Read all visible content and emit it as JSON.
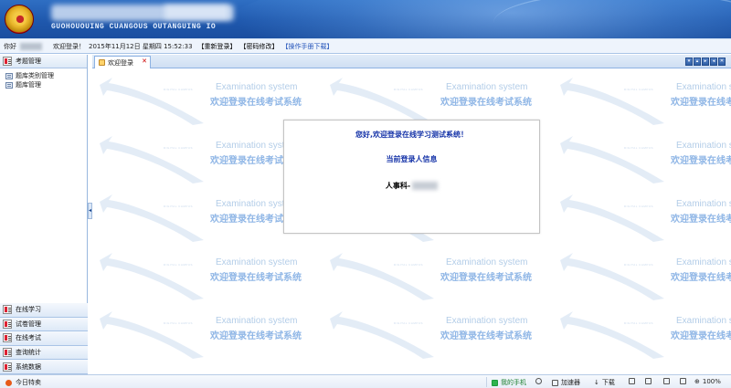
{
  "header": {
    "subtitle": "GUOHOUOUING CUANGOUS OUTANGUING IO"
  },
  "infobar": {
    "greeting": "你好",
    "welcome": "欢迎登录！",
    "datetime": "2015年11月12日 星期四 15:52:33",
    "relogin": "【重新登录】",
    "change_password": "【密码修改】",
    "manual_download": "【操作手册下载】"
  },
  "sidebar": {
    "top_section": "考题管理",
    "tree": [
      {
        "label": "题库类别管理"
      },
      {
        "label": "题库管理"
      }
    ],
    "bottom_sections": [
      {
        "label": "在线学习"
      },
      {
        "label": "试卷管理"
      },
      {
        "label": "在线考试"
      },
      {
        "label": "查询统计"
      },
      {
        "label": "系统数据"
      }
    ]
  },
  "tabs": {
    "active_label": "欢迎登录",
    "close_glyph": "✕",
    "tools": [
      "▾",
      "▴",
      "▸",
      "◂",
      "✕"
    ]
  },
  "watermark": {
    "english": "Examination system",
    "chinese": "欢迎登录在线考试系统",
    "tiny": "DIGITAL CAMPUS"
  },
  "dialog": {
    "greeting": "您好,欢迎登录在线学习测试系统！",
    "current_user_title": "当前登录人信息",
    "user_prefix": "人事科-"
  },
  "statusbar": {
    "left_text": "今日特卖",
    "my_phone": "我的手机",
    "accelerator": "加速器",
    "download": "下载",
    "zoom": "100%"
  },
  "colors": {
    "header": "#1f58ad",
    "accent_blue": "#1533a8",
    "watermark_blue": "#8fb6e6"
  }
}
